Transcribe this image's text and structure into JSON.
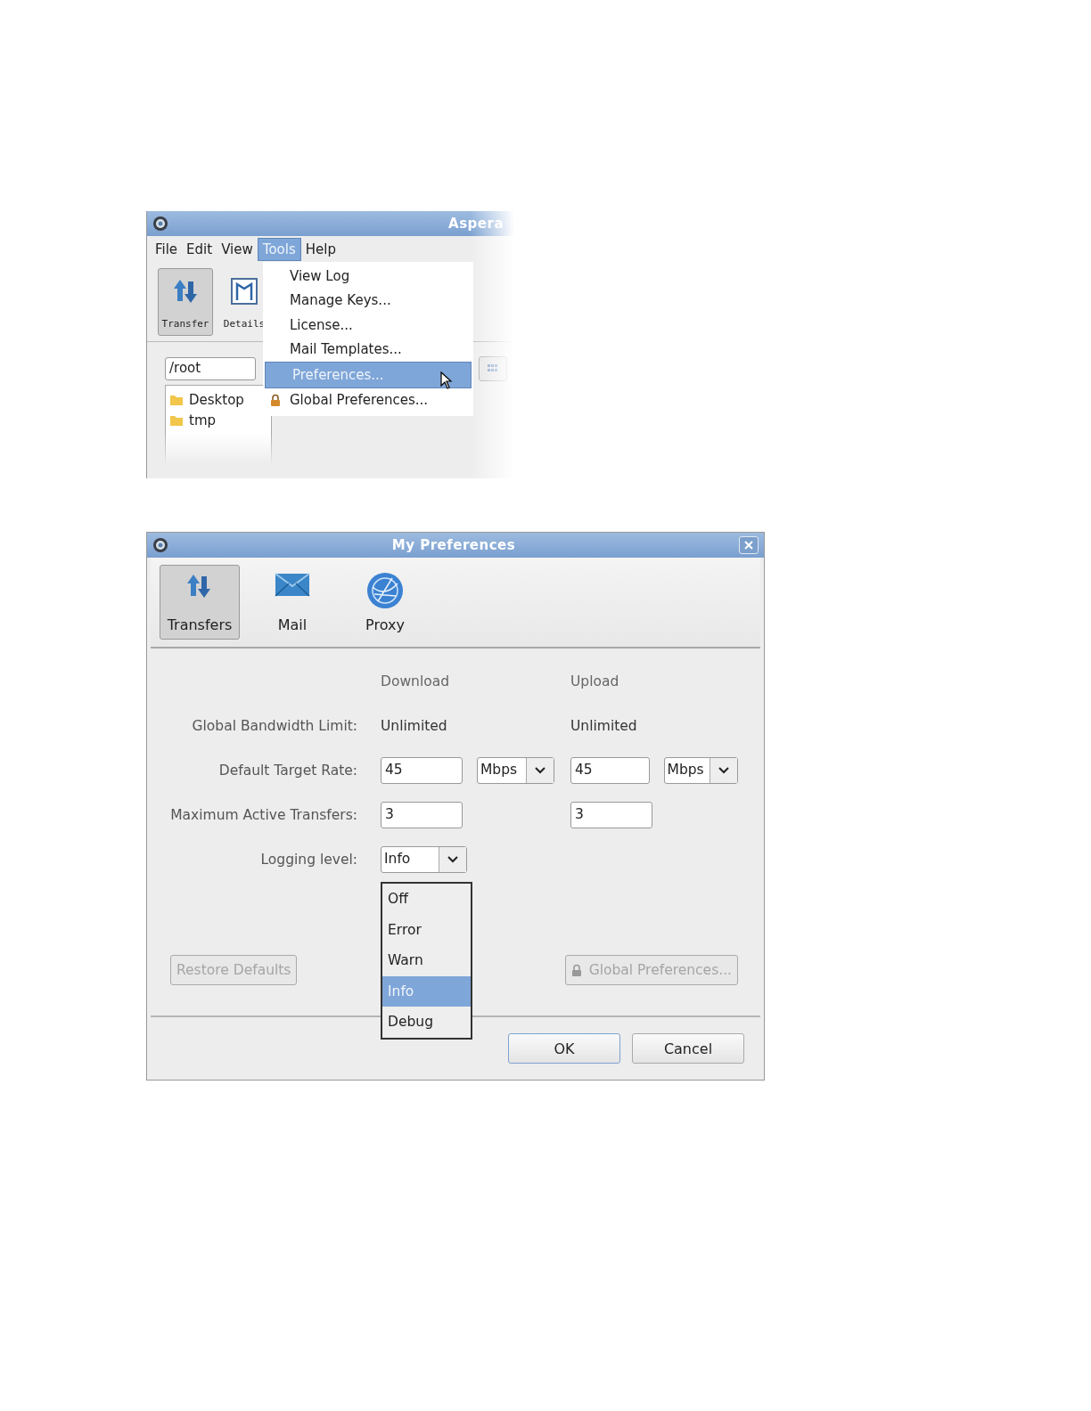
{
  "main_window": {
    "title": "Aspera",
    "menu": [
      {
        "label": "File",
        "selected": false
      },
      {
        "label": "Edit",
        "selected": false
      },
      {
        "label": "View",
        "selected": false
      },
      {
        "label": "Tools",
        "selected": true
      },
      {
        "label": "Help",
        "selected": false
      }
    ],
    "toolbar": [
      {
        "label": "Transfer",
        "kind": "transfer",
        "selected": true
      },
      {
        "label": "Details",
        "kind": "details",
        "selected": false
      }
    ],
    "path": "/root",
    "files": [
      "Desktop",
      "tmp"
    ],
    "tools_menu": [
      {
        "label": "View Log",
        "selected": false,
        "locked": false
      },
      {
        "label": "Manage Keys...",
        "selected": false,
        "locked": false
      },
      {
        "label": "License...",
        "selected": false,
        "locked": false
      },
      {
        "label": "Mail Templates...",
        "selected": false,
        "locked": false
      },
      {
        "label": "Preferences...",
        "selected": true,
        "locked": false
      },
      {
        "label": "Global Preferences...",
        "selected": false,
        "locked": true
      }
    ]
  },
  "preferences_dialog": {
    "title": "My Preferences",
    "categories": [
      {
        "label": "Transfers",
        "kind": "transfer",
        "selected": true
      },
      {
        "label": "Mail",
        "kind": "mail",
        "selected": false
      },
      {
        "label": "Proxy",
        "kind": "proxy",
        "selected": false
      }
    ],
    "columns": [
      "Download",
      "Upload"
    ],
    "bandwidth_label": "Global Bandwidth Limit:",
    "bandwidth": [
      "Unlimited",
      "Unlimited"
    ],
    "rate_label": "Default Target Rate:",
    "rates": [
      {
        "value": "45",
        "unit": "Mbps"
      },
      {
        "value": "45",
        "unit": "Mbps"
      }
    ],
    "max_label": "Maximum Active Transfers:",
    "max_transfers": [
      "3",
      "3"
    ],
    "logging_label": "Logging level:",
    "logging_value": "Info",
    "logging_options": [
      {
        "label": "Off",
        "selected": false
      },
      {
        "label": "Error",
        "selected": false
      },
      {
        "label": "Warn",
        "selected": false
      },
      {
        "label": "Info",
        "selected": true
      },
      {
        "label": "Debug",
        "selected": false
      }
    ],
    "restore_button": {
      "label": "Restore Defaults",
      "disabled": true
    },
    "global_button": {
      "label": "Global Preferences...",
      "disabled": true,
      "locked": true
    },
    "buttons": [
      {
        "label": "OK",
        "kind": "default"
      },
      {
        "label": "Cancel",
        "kind": "normal"
      }
    ]
  }
}
